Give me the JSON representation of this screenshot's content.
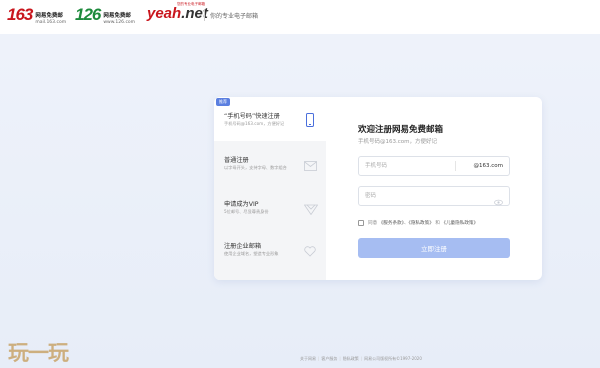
{
  "header": {
    "logo_163": {
      "num": "163",
      "cn": "网易免费邮",
      "domain": "mail.163.com"
    },
    "logo_126": {
      "num": "126",
      "cn": "网易免费邮",
      "domain": "www.126.com"
    },
    "logo_yeah": {
      "main": "yeah",
      "net": ".net",
      "tag": "您的专业电子邮箱"
    },
    "slogan": "你的专业电子邮箱"
  },
  "sidebar": {
    "badge": "推荐",
    "items": [
      {
        "title": "“手机号码”快速注册",
        "desc": "手机号码@163.com，方便好记",
        "icon": "phone-icon"
      },
      {
        "title": "普通注册",
        "desc": "以字母开头，支持字母、数字组合",
        "icon": "envelope-icon"
      },
      {
        "title": "申请成为VIP",
        "desc": "5位邮号、尽显尊贵身份",
        "icon": "vip-diamond-icon"
      },
      {
        "title": "注册企业邮箱",
        "desc": "使用企业域名，塑造专业形象",
        "icon": "heart-icon"
      }
    ]
  },
  "form": {
    "title": "欢迎注册网易免费邮箱",
    "subtitle": "手机号码@163.com，方便好记",
    "phone_placeholder": "手机号码",
    "phone_suffix": "@163.com",
    "password_placeholder": "密码",
    "agree_prefix": "同意",
    "agree_link1": "《服务条款》",
    "agree_sep1": "、",
    "agree_link2": "《隐私政策》",
    "agree_sep2": "和",
    "agree_link3": "《儿童隐私政策》",
    "submit_label": "立即注册"
  },
  "watermark": "玩一玩",
  "footer": {
    "links": [
      "关于网易",
      "客户服务",
      "隐私政策"
    ],
    "copyright": "网易公司版权所有©1997-2020"
  }
}
